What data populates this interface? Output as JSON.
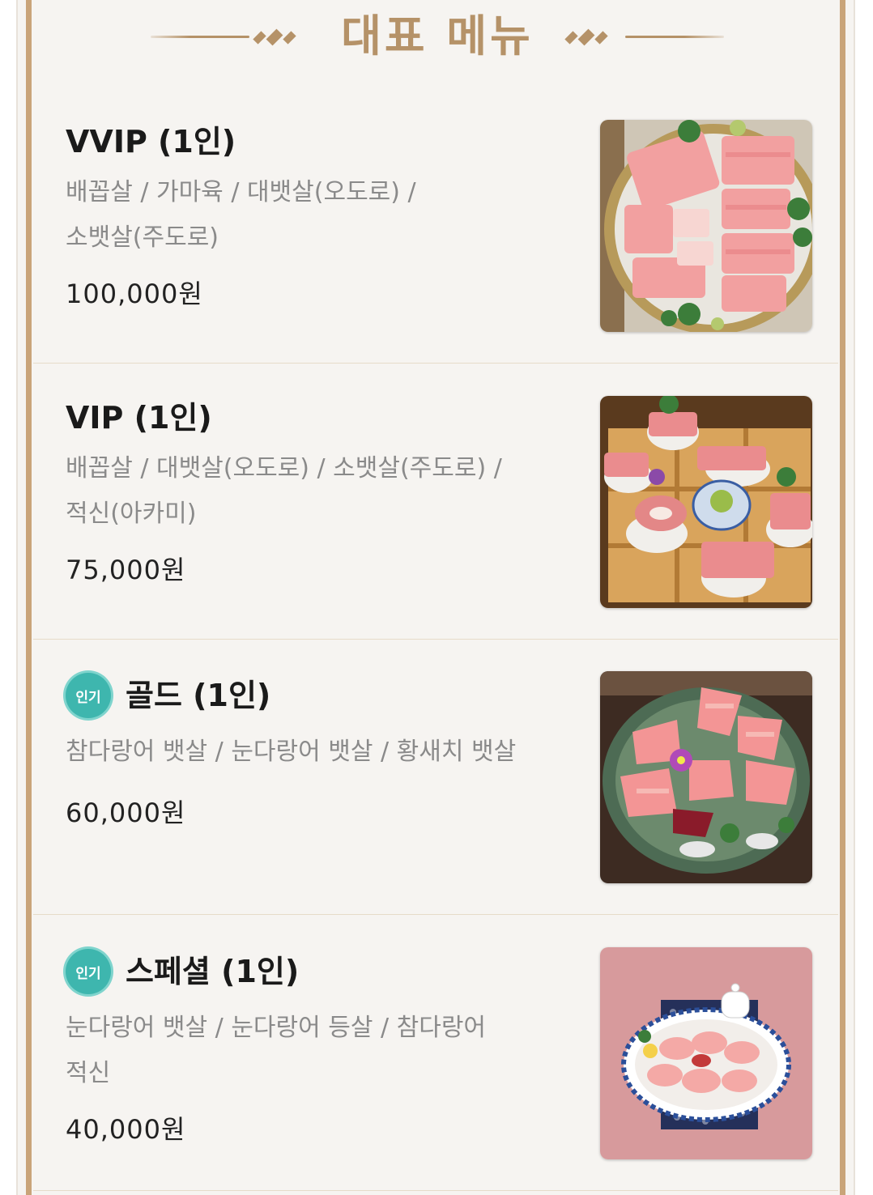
{
  "header": {
    "title": "대표 메뉴"
  },
  "colors": {
    "accent_gold": "#b59268",
    "badge_teal": "#3eb6ae",
    "frame_brown": "#c9a479"
  },
  "menu": [
    {
      "name": "VVIP (1인)",
      "badge": "",
      "desc_line1": "배꼽살 / 가마육 / 대뱃살(오도로) /",
      "desc_line2": "소뱃살(주도로)",
      "price": "100,000원",
      "photo_icon": "tuna-sashimi-platter-photo"
    },
    {
      "name": "VIP (1인)",
      "badge": "",
      "desc_line1": "배꼽살 / 대뱃살(오도로) / 소뱃살(주도로) /",
      "desc_line2": "적신(아카미)",
      "price": "75,000원",
      "photo_icon": "tuna-wooden-box-photo"
    },
    {
      "name": "골드 (1인)",
      "badge": "인기",
      "desc_line1": "참다랑어 뱃살 / 눈다랑어 뱃살 / 황새치 뱃살",
      "desc_line2": "",
      "price": "60,000원",
      "photo_icon": "tuna-ceramic-bowl-photo"
    },
    {
      "name": "스페셜 (1인)",
      "badge": "인기",
      "desc_line1": "눈다랑어 뱃살 / 눈다랑어 등살 / 참다랑어",
      "desc_line2": "적신",
      "price": "40,000원",
      "photo_icon": "tuna-plate-pink-cloth-photo"
    }
  ]
}
